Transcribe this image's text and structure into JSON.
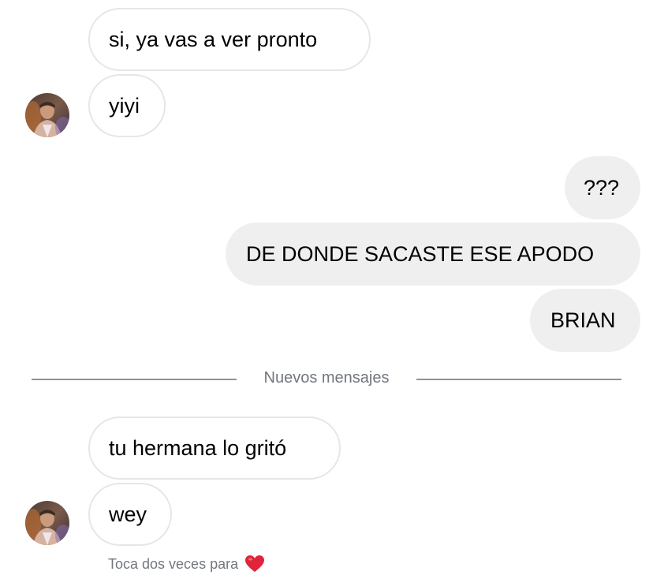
{
  "thread": {
    "messages": [
      {
        "id": "m1",
        "direction": "incoming",
        "text": "si, ya vas a ver pronto"
      },
      {
        "id": "m2",
        "direction": "incoming",
        "text": "yiyi"
      },
      {
        "id": "m3",
        "direction": "outgoing",
        "text": "???"
      },
      {
        "id": "m4",
        "direction": "outgoing",
        "text": "DE DONDE SACASTE ESE APODO"
      },
      {
        "id": "m5",
        "direction": "outgoing",
        "text": "BRIAN"
      },
      {
        "id": "m6",
        "direction": "incoming",
        "text": "tu hermana lo gritó"
      },
      {
        "id": "m7",
        "direction": "incoming",
        "text": "wey"
      }
    ],
    "new_messages_divider": "Nuevos mensajes",
    "like_hint": "Toca dos veces para",
    "like_hint_icon": "red-heart-icon"
  },
  "colors": {
    "incoming_border": "#e6e6e9",
    "outgoing_bg": "#efeff0",
    "divider": "#8e939b",
    "muted_text": "#73777f",
    "heart": "#e0243a"
  }
}
